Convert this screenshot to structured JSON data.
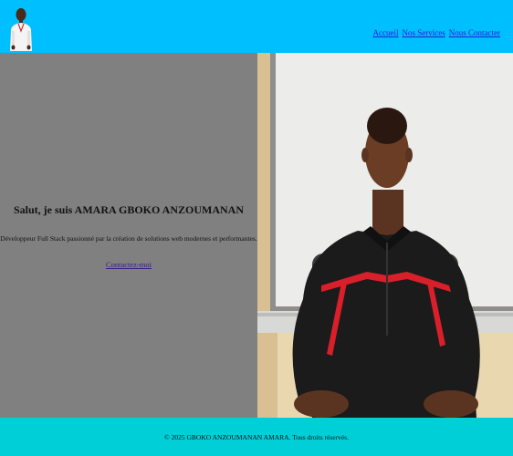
{
  "header": {
    "nav": [
      {
        "label": "Accueil"
      },
      {
        "label": "Nos Services"
      },
      {
        "label": "Nous Contacter"
      }
    ]
  },
  "hero": {
    "title": "Salut, je suis AMARA GBOKO ANZOUMANAN",
    "subtitle": "Développeur Full Stack passionné par la création de solutions web modernes et performantes.",
    "cta": "Contactez-moi"
  },
  "footer": {
    "text": "© 2025 GBOKO ANZOUMANAN AMARA. Tous droits réservés."
  },
  "colors": {
    "header_bg": "#00bfff",
    "hero_left_bg": "#808080",
    "footer_bg": "#00cfd8",
    "link": "#2a1bd6"
  }
}
